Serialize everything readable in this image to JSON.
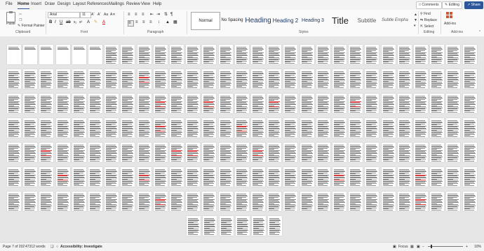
{
  "tabs": [
    "File",
    "Home",
    "Insert",
    "Draw",
    "Design",
    "Layout",
    "References",
    "Mailings",
    "Review",
    "View",
    "Help"
  ],
  "active_tab": "Home",
  "top_buttons": {
    "comments": "Comments",
    "editing": "Editing",
    "share": "Share"
  },
  "clipboard": {
    "paste": "Paste",
    "format_painter": "Format Painter",
    "group": "Clipboard"
  },
  "font": {
    "name": "Arial",
    "size": "11",
    "group": "Font"
  },
  "paragraph": {
    "group": "Paragraph"
  },
  "styles": {
    "items": [
      "Normal",
      "No Spacing",
      "Heading",
      "Heading 2",
      "Heading 3",
      "Title",
      "Subtitle",
      "Subtle Empha"
    ],
    "group": "Styles"
  },
  "editing": {
    "find": "Find",
    "replace": "Replace",
    "select": "Select",
    "group": "Editing"
  },
  "addins": {
    "label": "Add-ins",
    "group": "Add-ins"
  },
  "status": {
    "page": "Page 7 of 202",
    "words": "47312 words",
    "accessibility": "Accessibility: Investigate",
    "focus": "Focus",
    "zoom": "10%"
  },
  "document": {
    "pages_per_row": 29,
    "full_rows": 7,
    "last_row_pages": 6,
    "red_mark_pages": [
      37,
      67,
      70,
      74,
      79,
      96,
      101,
      118,
      126,
      127,
      131,
      148,
      153,
      165,
      170,
      183,
      199
    ]
  }
}
